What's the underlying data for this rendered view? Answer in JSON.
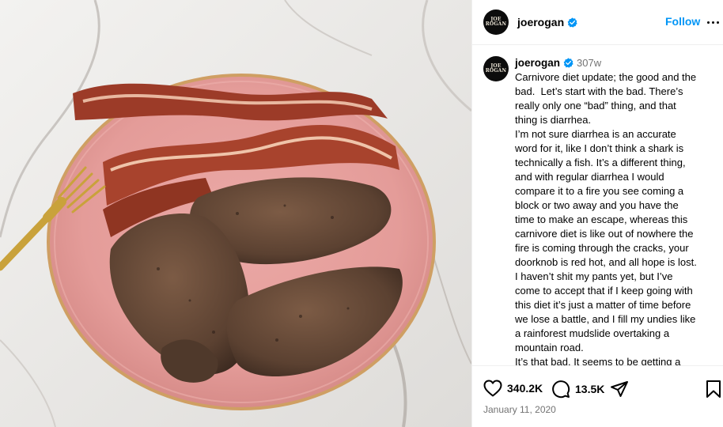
{
  "post": {
    "photo_alt": "Plate with steaks and bacon",
    "author": {
      "username": "joerogan",
      "avatar_line1": "JOE",
      "avatar_line2": "ROGAN",
      "verified": true
    },
    "header": {
      "follow_label": "Follow",
      "more_icon": "more-horizontal-icon"
    },
    "caption": {
      "time_ago": "307w",
      "text": "Carnivore diet update; the good and the bad.  Let’s start with the bad. There’s really only one “bad” thing, and that thing is diarrhea.\nI’m not sure diarrhea is an accurate word for it, like I don’t think a shark is technically a fish. It’s a different thing, and with regular diarrhea I would compare it to a fire you see coming a block or two away and you have the time to make an escape, whereas this carnivore diet is like out of nowhere the fire is coming through the cracks, your doorknob is red hot, and all hope is lost.  I haven’t shit my pants yet, but I’ve come to accept that if I keep going with this diet it’s just a matter of time before we lose a battle, and I fill my undies like a rainforest mudslide overtaking a mountain road.\nIt’s that bad. It seems to be getting a"
    },
    "actions": {
      "likes": "340.2K",
      "comments": "13.5K",
      "icons": [
        "heart-icon",
        "comment-icon",
        "share-icon",
        "bookmark-icon"
      ]
    },
    "date": "January 11, 2020",
    "colors": {
      "accent": "#0095f6",
      "verified": "#0095f6",
      "muted": "#737373",
      "plate": "#e8a3a0"
    }
  }
}
